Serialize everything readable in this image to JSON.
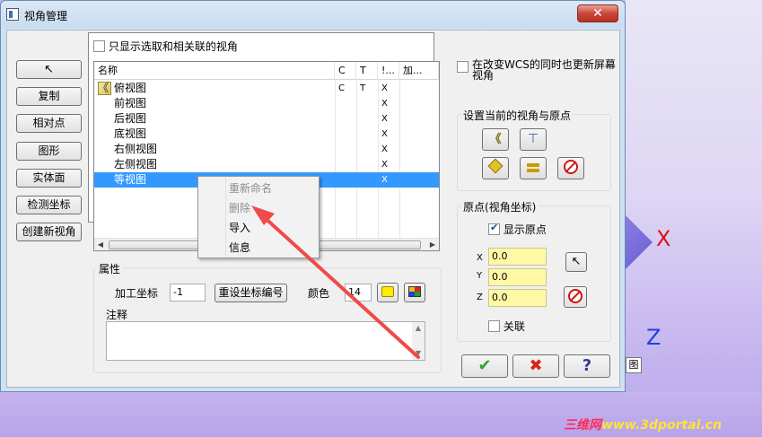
{
  "window": {
    "title": "视角管理",
    "close_symbol": "✕"
  },
  "left_buttons": {
    "select_symbol": "↖",
    "copy": "复制",
    "relative_point": "相对点",
    "graphics": "图形",
    "solid_face": "实体面",
    "check_coords": "检测坐标",
    "create_view": "创建新视角"
  },
  "filter": {
    "only_selected_label": "只显示选取和相关联的视角",
    "only_selected_checked": false
  },
  "list": {
    "headers": [
      "名称",
      "C",
      "T",
      "!...",
      "加..."
    ],
    "rows": [
      {
        "name": "俯视图",
        "c": "C",
        "t": "T",
        "x": "X",
        "selected": false
      },
      {
        "name": "前视图",
        "c": "",
        "t": "",
        "x": "X",
        "selected": false
      },
      {
        "name": "后视图",
        "c": "",
        "t": "",
        "x": "X",
        "selected": false
      },
      {
        "name": "底视图",
        "c": "",
        "t": "",
        "x": "X",
        "selected": false
      },
      {
        "name": "右侧视图",
        "c": "",
        "t": "",
        "x": "X",
        "selected": false
      },
      {
        "name": "左侧视图",
        "c": "",
        "t": "",
        "x": "X",
        "selected": false
      },
      {
        "name": "等视图",
        "c": "",
        "t": "",
        "x": "X",
        "selected": true
      }
    ]
  },
  "context_menu": {
    "items": [
      {
        "label": "重新命名",
        "enabled": false
      },
      {
        "label": "删除",
        "enabled": false
      },
      {
        "label": "导入",
        "enabled": true
      },
      {
        "label": "信息",
        "enabled": true
      }
    ]
  },
  "properties": {
    "title": "属性",
    "wcs_label": "加工坐标",
    "wcs_value": "-1",
    "reset_button": "重设坐标编号",
    "color_label": "颜色",
    "color_value": "14",
    "notes_label": "注释",
    "swatch_color": "#ffeb00"
  },
  "right_panel": {
    "update_screen_label": "在改变WCS的同时也更新屏幕视角",
    "update_screen_checked": false,
    "set_view_title": "设置当前的视角与原点",
    "origin_title": "原点(视角坐标)",
    "show_origin_label": "显示原点",
    "show_origin_checked": true,
    "x_label": "X",
    "x_value": "0.0",
    "y_label": "Y",
    "y_value": "0.0",
    "z_label": "Z",
    "z_value": "0.0",
    "link_label": "关联",
    "link_checked": false
  },
  "footer_buttons": {
    "ok_symbol": "✔",
    "cancel_symbol": "✖",
    "help_symbol": "?"
  },
  "background": {
    "axis_x": "X",
    "axis_z": "Z",
    "tail_char": "图",
    "watermark_a": "三维网",
    "watermark_b": "www.3dportal.cn"
  }
}
